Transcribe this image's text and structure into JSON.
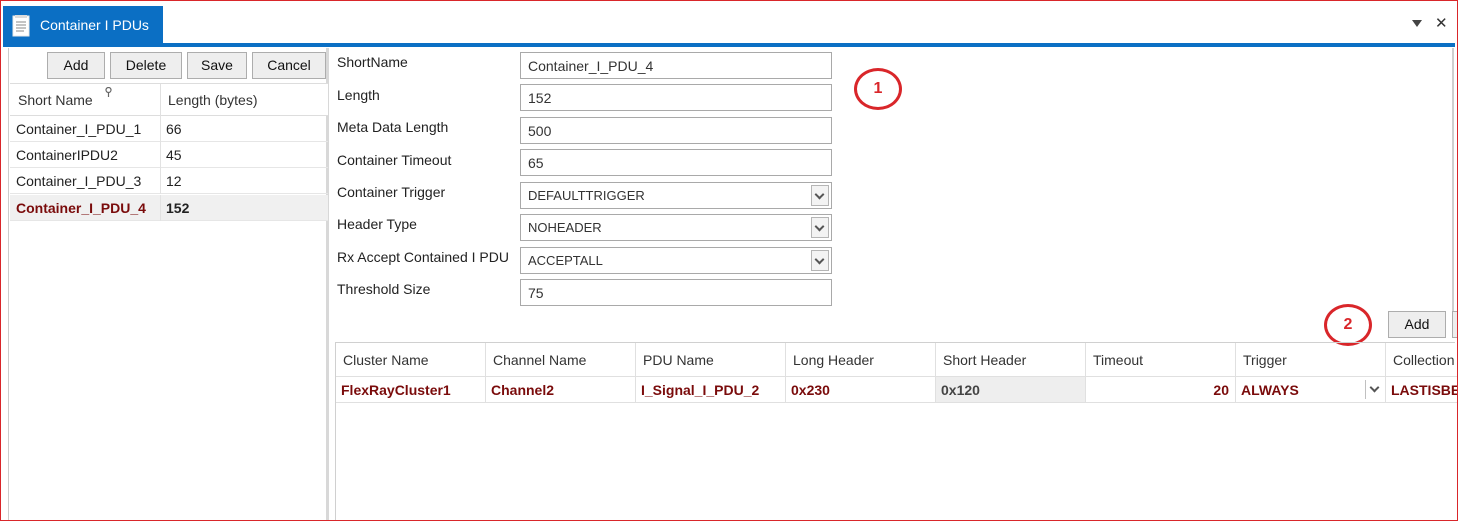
{
  "window": {
    "tab_title": "Container I PDUs",
    "icons": {
      "tab": "document-icon",
      "menu": "dropdown-arrow-icon",
      "close": "close-icon"
    }
  },
  "toolbar": {
    "add": "Add",
    "delete": "Delete",
    "save": "Save",
    "cancel": "Cancel"
  },
  "list": {
    "headers": [
      "Short Name",
      "Length (bytes)"
    ],
    "rows": [
      {
        "name": "Container_I_PDU_1",
        "length": "66"
      },
      {
        "name": "ContainerIPDU2",
        "length": "45"
      },
      {
        "name": "Container_I_PDU_3",
        "length": "12"
      },
      {
        "name": "Container_I_PDU_4",
        "length": "152",
        "selected": true
      }
    ]
  },
  "form": {
    "short_name": {
      "label": "ShortName",
      "value": "Container_I_PDU_4"
    },
    "length": {
      "label": "Length",
      "value": "152"
    },
    "meta_data_length": {
      "label": "Meta Data Length",
      "value": "500"
    },
    "container_timeout": {
      "label": "Container Timeout",
      "value": "65"
    },
    "container_trigger": {
      "label": "Container Trigger",
      "value": "DEFAULTTRIGGER"
    },
    "header_type": {
      "label": "Header Type",
      "value": "NOHEADER"
    },
    "rx_accept": {
      "label": "Rx Accept Contained I PDU",
      "value": "ACCEPTALL"
    },
    "threshold_size": {
      "label": "Threshold Size",
      "value": "75"
    }
  },
  "callouts": [
    "1",
    "2"
  ],
  "grid": {
    "add": "Add",
    "headers": [
      "Cluster Name",
      "Channel Name",
      "PDU Name",
      "Long Header",
      "Short Header",
      "Timeout",
      "Trigger",
      "Collection"
    ],
    "rows": [
      [
        "FlexRayCluster1",
        "Channel2",
        "I_Signal_I_PDU_2",
        "0x230",
        "0x120",
        "20",
        "ALWAYS",
        "LASTISBEST"
      ]
    ]
  },
  "colors": {
    "accent": "#0b6fc4",
    "callout": "#d9262a",
    "selected_text": "#7a0b0b"
  }
}
